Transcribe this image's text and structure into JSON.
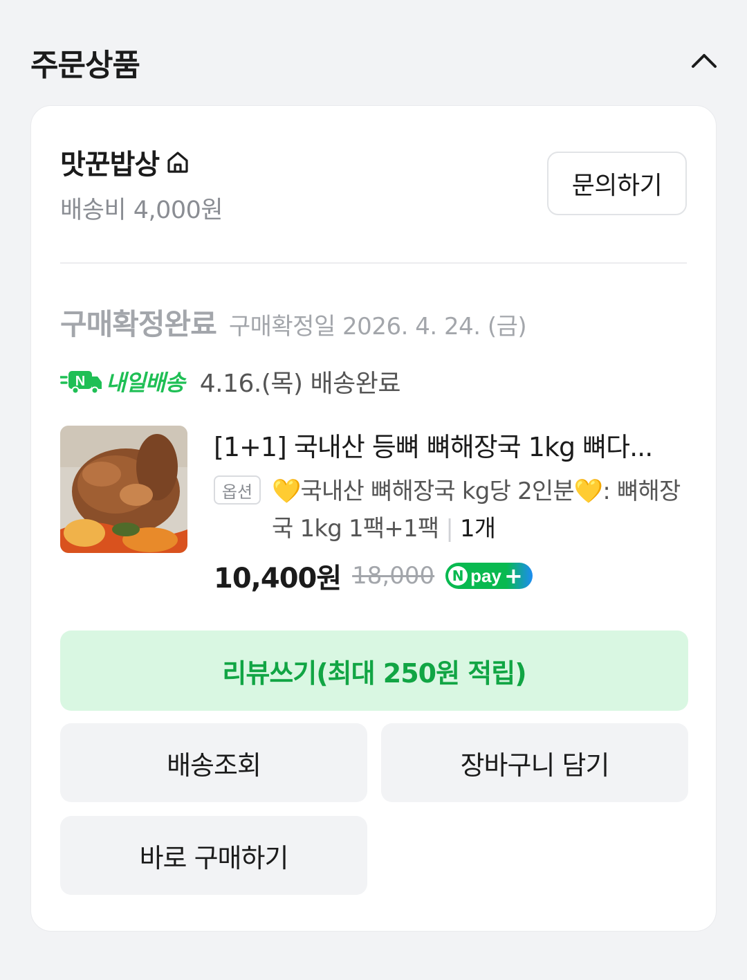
{
  "section": {
    "title": "주문상품"
  },
  "store": {
    "name": "맛꾼밥상",
    "shipping_fee": "배송비 4,000원",
    "inquiry_label": "문의하기"
  },
  "order": {
    "status": "구매확정완료",
    "confirm_date": "구매확정일 2026. 4. 24. (금)",
    "delivery_badge": "내일배송",
    "delivery_status": "4.16.(목) 배송완료"
  },
  "product": {
    "title": "[1+1] 국내산 등뼈 뼈해장국 1kg 뼈다...",
    "option_tag": "옵션",
    "option_text": "💛국내산 뼈해장국 kg당 2인분💛: 뼈해장국 1kg 1팩+1팩",
    "quantity": "1개",
    "price": "10,400원",
    "original_price": "18,000",
    "npay_label": "pay"
  },
  "actions": {
    "review": "리뷰쓰기(최대 250원 적립)",
    "track_delivery": "배송조회",
    "add_to_cart": "장바구니 담기",
    "buy_now": "바로 구매하기"
  },
  "colors": {
    "accent_green": "#11a544",
    "review_bg": "#d9f7e2",
    "npay_green": "#09b950",
    "npay_blue": "#1d8cf2"
  }
}
